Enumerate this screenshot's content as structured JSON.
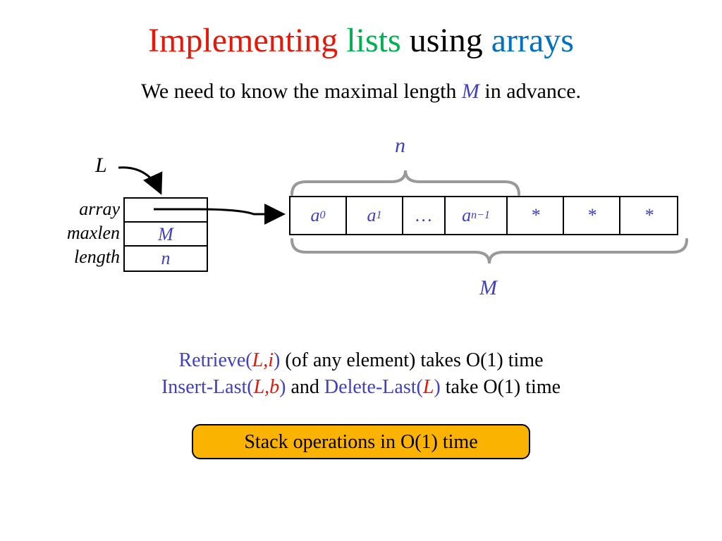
{
  "title": {
    "w1": "Implementing",
    "w2": "lists",
    "w3": "using",
    "w4": "arrays"
  },
  "subtitle": {
    "pre": "We need to know the maximal length ",
    "M": "M",
    "post": " in advance."
  },
  "diagram": {
    "L": "L",
    "fields": {
      "array": "array",
      "maxlen": "maxlen",
      "length": "length"
    },
    "struct": {
      "array": "",
      "maxlen": "M",
      "length": "n"
    },
    "cells": [
      "a",
      "a",
      "…",
      "a",
      "*",
      "*",
      "*"
    ],
    "cell_subs": [
      "0",
      "1",
      "",
      "n−1",
      "",
      "",
      ""
    ],
    "n": "n",
    "M": "M"
  },
  "ops": {
    "retrieve": {
      "name": "Retrieve(",
      "args": "L,i",
      "close": ")",
      "tail": " (of any element) takes O(1) time"
    },
    "insert": {
      "name": "Insert-Last(",
      "args": "L,b",
      "close": ")"
    },
    "and": " and ",
    "delete": {
      "name": "Delete-Last(",
      "args": "L",
      "close": ")"
    },
    "tail2": "  take O(1) time"
  },
  "callout": "Stack operations in O(1) time"
}
